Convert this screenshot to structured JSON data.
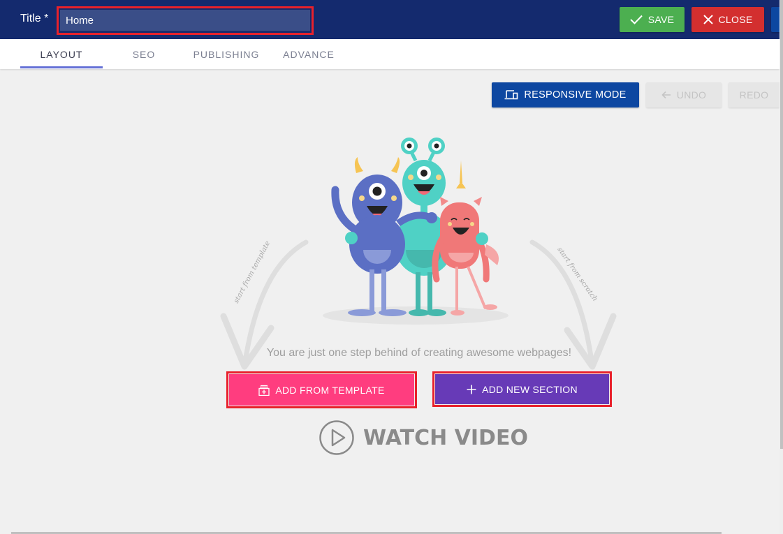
{
  "header": {
    "title_label": "Title *",
    "title_value": "Home",
    "save_label": "SAVE",
    "close_label": "CLOSE",
    "colors": {
      "bar": "#142a6e",
      "save": "#4caf50",
      "close": "#d32f2f"
    }
  },
  "tabs": [
    {
      "label": "LAYOUT",
      "active": true
    },
    {
      "label": "SEO",
      "active": false
    },
    {
      "label": "PUBLISHING",
      "active": false
    },
    {
      "label": "ADVANCE",
      "active": false
    }
  ],
  "toolbar": {
    "responsive_label": "RESPONSIVE MODE",
    "undo_label": "UNDO",
    "redo_label": "REDO",
    "undo_disabled": true,
    "redo_disabled": true
  },
  "empty_state": {
    "illustration": "three-monsters",
    "arrow_left_text": "start from template",
    "arrow_right_text": "start from scratch",
    "tagline": "You are just one step behind of creating awesome webpages!",
    "add_template_label": "ADD FROM TEMPLATE",
    "add_section_label": "ADD NEW SECTION",
    "watch_video_label": "WATCH VIDEO",
    "colors": {
      "template": "#ff3d7f",
      "section": "#673ab7",
      "highlight": "#e8212b"
    }
  }
}
